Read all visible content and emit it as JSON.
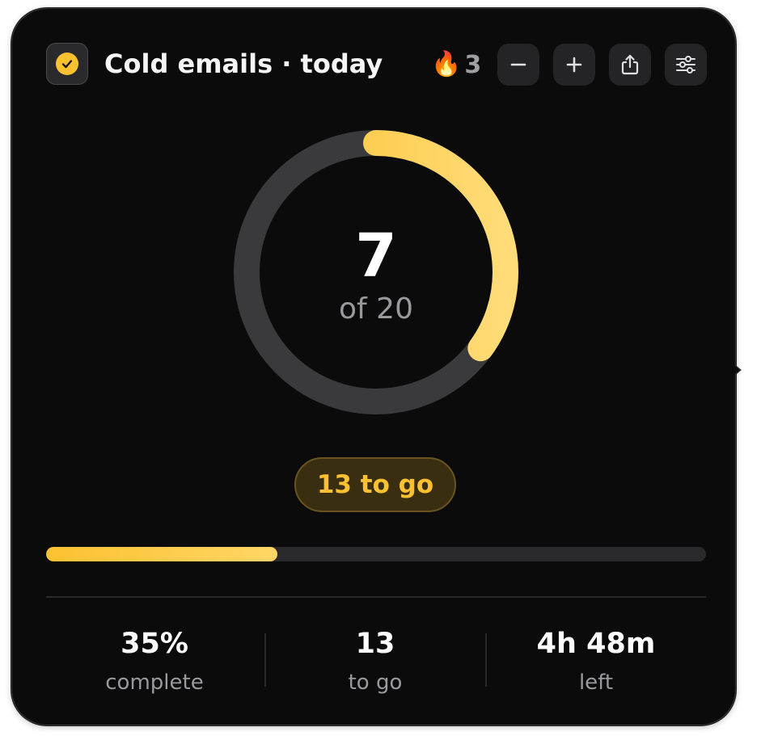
{
  "header": {
    "title": "Cold emails · today",
    "streak_icon": "🔥",
    "streak_count": "3",
    "check_icon": "check-circle-icon",
    "buttons": [
      {
        "name": "decrement-button",
        "icon": "minus-icon"
      },
      {
        "name": "increment-button",
        "icon": "plus-icon"
      },
      {
        "name": "share-button",
        "icon": "share-icon"
      },
      {
        "name": "settings-button",
        "icon": "sliders-icon"
      }
    ]
  },
  "progress": {
    "current": "7",
    "of_label": "of 20",
    "goal": 20,
    "done": 7,
    "fraction": 0.35,
    "remaining_label": "13 to go"
  },
  "stats": [
    {
      "value": "35%",
      "label": "complete"
    },
    {
      "value": "13",
      "label": "to go"
    },
    {
      "value": "4h 48m",
      "label": "left"
    }
  ],
  "colors": {
    "accent": "#fcc130",
    "accent_light": "#ffd666",
    "background": "#0b0b0c",
    "track": "#3a3a3c"
  }
}
